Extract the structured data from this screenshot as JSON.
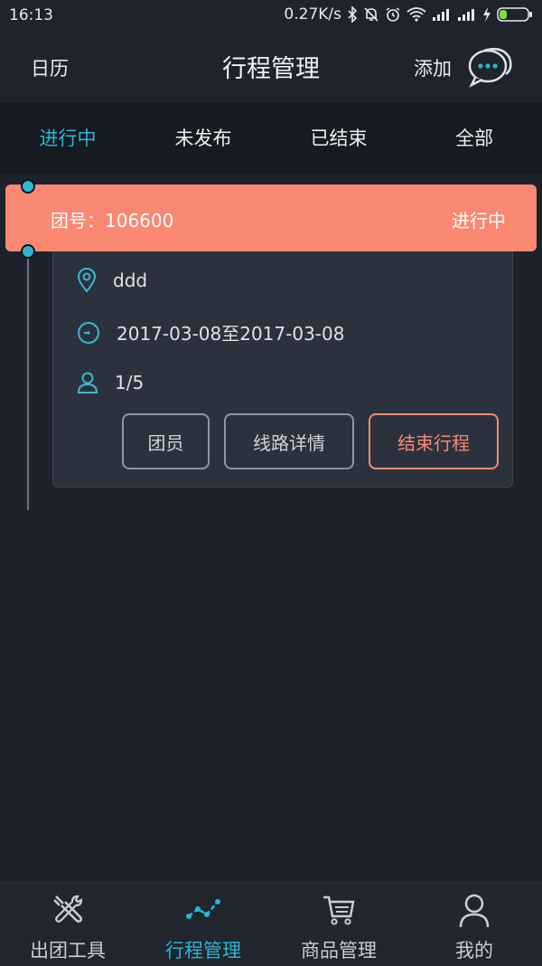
{
  "status_bar": {
    "time": "16:13",
    "speed": "0.27K/s"
  },
  "header": {
    "left_link": "日历",
    "title": "行程管理",
    "add_label": "添加",
    "chat_icon": "chat-bubble-icon"
  },
  "tabs": [
    {
      "label": "进行中",
      "active": true
    },
    {
      "label": "未发布",
      "active": false
    },
    {
      "label": "已结束",
      "active": false
    },
    {
      "label": "全部",
      "active": false
    }
  ],
  "trip": {
    "team_label": "团号：106600",
    "status": "进行中",
    "location": "ddd",
    "date_range": "2017-03-08至2017-03-08",
    "members": "1/5",
    "buttons": {
      "members": "团员",
      "route": "线路详情",
      "end": "结束行程"
    }
  },
  "bottom_nav": [
    {
      "label": "出团工具",
      "icon": "tools-icon",
      "active": false
    },
    {
      "label": "行程管理",
      "icon": "trend-icon",
      "active": true
    },
    {
      "label": "商品管理",
      "icon": "cart-icon",
      "active": false
    },
    {
      "label": "我的",
      "icon": "user-icon",
      "active": false
    }
  ],
  "colors": {
    "accent": "#2ab7d6",
    "banner": "#fb8872",
    "background": "#1d222c"
  }
}
